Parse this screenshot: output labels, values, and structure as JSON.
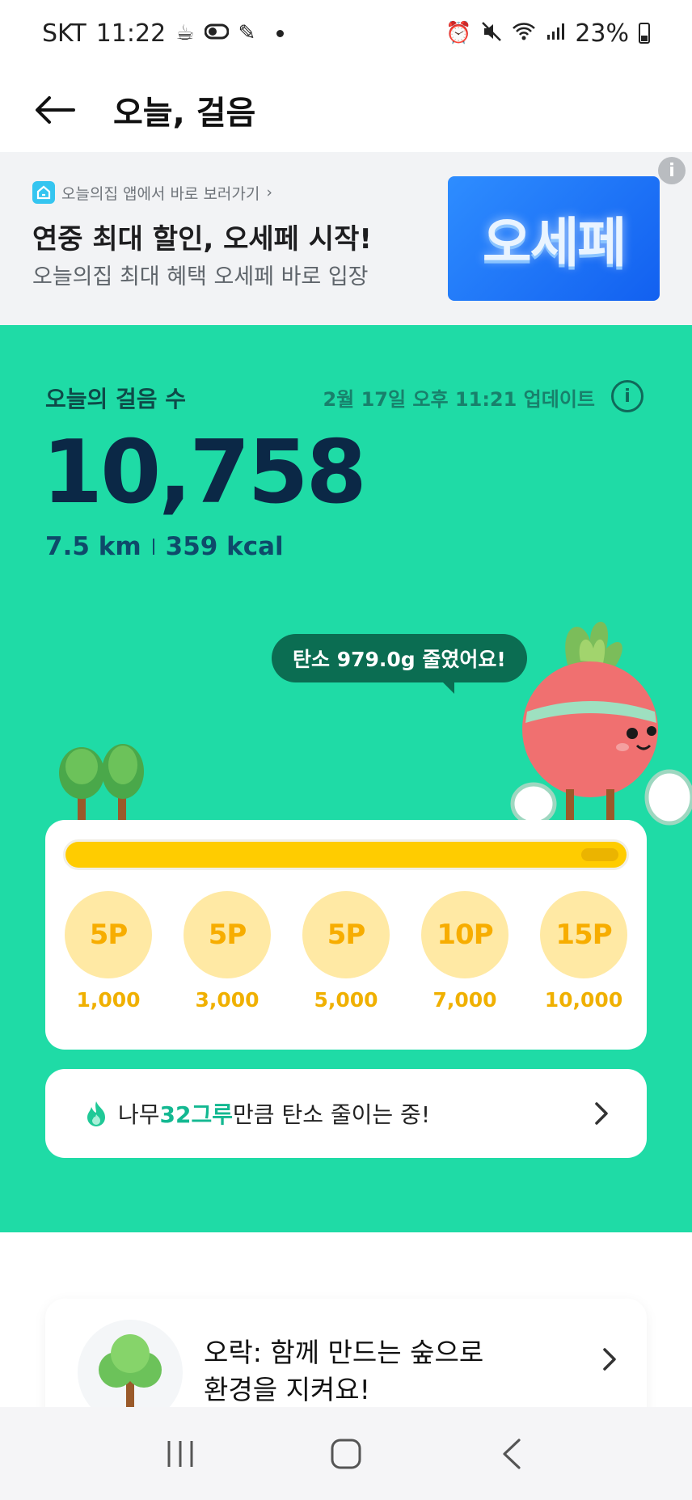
{
  "status_bar": {
    "carrier": "SKT",
    "time": "11:22",
    "battery": "23%",
    "icons": [
      "coffee-icon",
      "toggle-icon",
      "pen-icon",
      "alarm-icon",
      "mute-icon",
      "wifi-icon",
      "signal-icon",
      "battery-icon"
    ]
  },
  "header": {
    "title": "오늘, 걸음",
    "back_icon": "arrow-left-icon"
  },
  "ad": {
    "source": "오늘의집 앱에서 바로 보러가기",
    "headline": "연중 최대 할인, 오세페 시작!",
    "subtext": "오늘의집 최대 혜택 오세페 바로 입장",
    "promo_text": "오세페",
    "info_icon": "i",
    "promo_color": "#2e8dff"
  },
  "steps": {
    "label": "오늘의 걸음 수",
    "updated": "2월 17일 오후 11:21 업데이트",
    "info_icon": "i",
    "value": "10,758",
    "distance": "7.5 km",
    "calories": "359 kcal",
    "carbon_message": "탄소 979.0g 줄였어요!"
  },
  "progress": {
    "fraction": 1.0,
    "fill_color": "#ffcc00",
    "rewards": [
      {
        "points": "5P",
        "steps": "1,000"
      },
      {
        "points": "5P",
        "steps": "3,000"
      },
      {
        "points": "5P",
        "steps": "5,000"
      },
      {
        "points": "10P",
        "steps": "7,000"
      },
      {
        "points": "15P",
        "steps": "10,000"
      }
    ]
  },
  "tree_banner": {
    "prefix": "나무 ",
    "count": "32그루",
    "suffix": " 만큼 탄소 줄이는 중!"
  },
  "forest_card": {
    "line1": "오락: 함께 만드는 숲으로",
    "line2": "환경을 지켜요!"
  },
  "colors": {
    "green_bg": "#1fdba6",
    "dark_text": "#0b2846",
    "accent_green": "#13b891"
  }
}
